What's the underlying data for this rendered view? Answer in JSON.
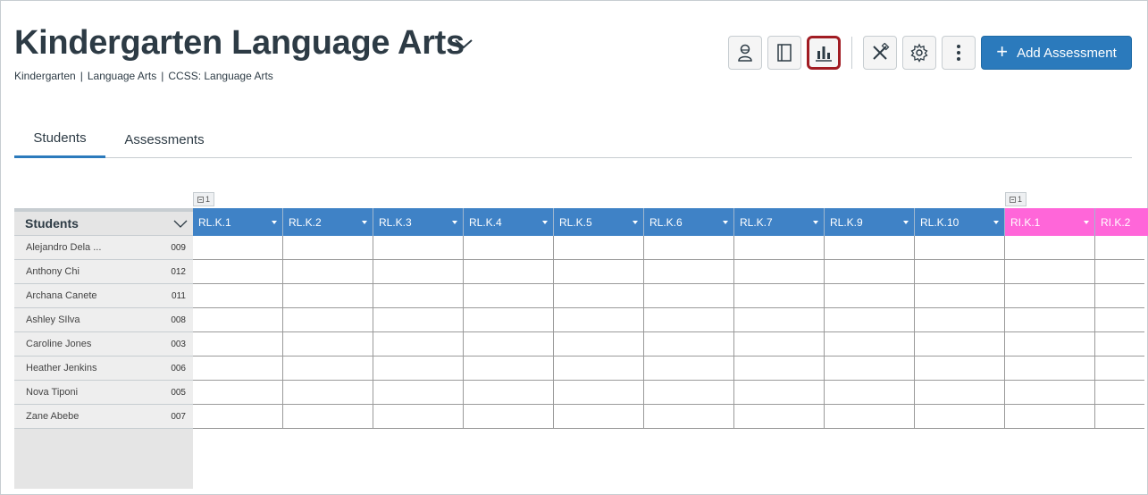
{
  "header": {
    "title": "Kindergarten Language Arts",
    "breadcrumb": [
      "Kindergarten",
      "Language Arts",
      "CCSS: Language Arts"
    ],
    "breadcrumb_separator": "|"
  },
  "toolbar": {
    "buttons": [
      {
        "name": "student-view-button",
        "icon": "student-icon",
        "active": false
      },
      {
        "name": "gradebook-button",
        "icon": "notebook-icon",
        "active": false
      },
      {
        "name": "reports-button",
        "icon": "bar-chart-icon",
        "active": true
      },
      {
        "name": "tools-button",
        "icon": "tools-icon",
        "active": false
      },
      {
        "name": "settings-button",
        "icon": "gear-icon",
        "active": false
      },
      {
        "name": "more-options-button",
        "icon": "more-vertical-icon",
        "active": false
      }
    ],
    "add_label": "Add Assessment"
  },
  "tabs": [
    {
      "label": "Students",
      "active": true
    },
    {
      "label": "Assessments",
      "active": false
    }
  ],
  "groups": [
    {
      "count": "1"
    },
    {
      "count": "1"
    }
  ],
  "table": {
    "students_header": "Students",
    "columns": [
      {
        "label": "RL.K.1",
        "color": "#3f82c6"
      },
      {
        "label": "RL.K.2",
        "color": "#3f82c6"
      },
      {
        "label": "RL.K.3",
        "color": "#3f82c6"
      },
      {
        "label": "RL.K.4",
        "color": "#3f82c6"
      },
      {
        "label": "RL.K.5",
        "color": "#3f82c6"
      },
      {
        "label": "RL.K.6",
        "color": "#3f82c6"
      },
      {
        "label": "RL.K.7",
        "color": "#3f82c6"
      },
      {
        "label": "RL.K.9",
        "color": "#3f82c6"
      },
      {
        "label": "RL.K.10",
        "color": "#3f82c6"
      },
      {
        "label": "RI.K.1",
        "color": "#ff66d9"
      },
      {
        "label": "RI.K.2",
        "color": "#ff66d9"
      }
    ],
    "students": [
      {
        "name": "Alejandro Dela ...",
        "id": "009"
      },
      {
        "name": "Anthony Chi",
        "id": "012"
      },
      {
        "name": "Archana Canete",
        "id": "011"
      },
      {
        "name": "Ashley SIlva",
        "id": "008"
      },
      {
        "name": "Caroline Jones",
        "id": "003"
      },
      {
        "name": "Heather Jenkins",
        "id": "006"
      },
      {
        "name": "Nova Tiponi",
        "id": "005"
      },
      {
        "name": "Zane Abebe",
        "id": "007"
      }
    ]
  }
}
